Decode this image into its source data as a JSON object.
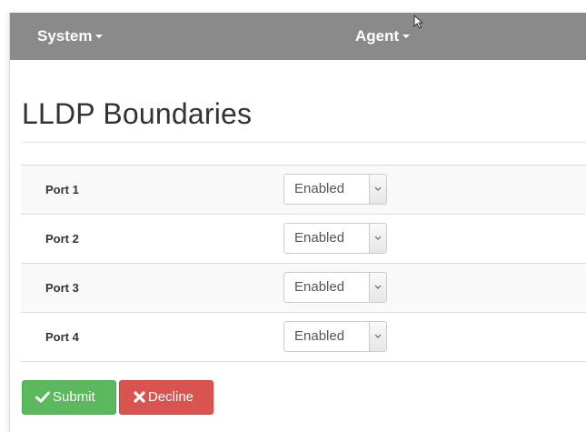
{
  "navbar": {
    "items": [
      {
        "label": "System",
        "icon": "caret-down-icon"
      },
      {
        "label": "Agent",
        "icon": "caret-down-icon"
      }
    ]
  },
  "page": {
    "title": "LLDP Boundaries"
  },
  "ports": [
    {
      "label": "Port 1",
      "value": "Enabled"
    },
    {
      "label": "Port 2",
      "value": "Enabled"
    },
    {
      "label": "Port 3",
      "value": "Enabled"
    },
    {
      "label": "Port 4",
      "value": "Enabled"
    }
  ],
  "actions": {
    "submit_label": "Submit",
    "submit_icon": "check-icon",
    "decline_label": "Decline",
    "decline_icon": "x-icon"
  },
  "colors": {
    "navbar": "#8a8a8a",
    "submit": "#5cb85c",
    "decline": "#d9534f"
  }
}
